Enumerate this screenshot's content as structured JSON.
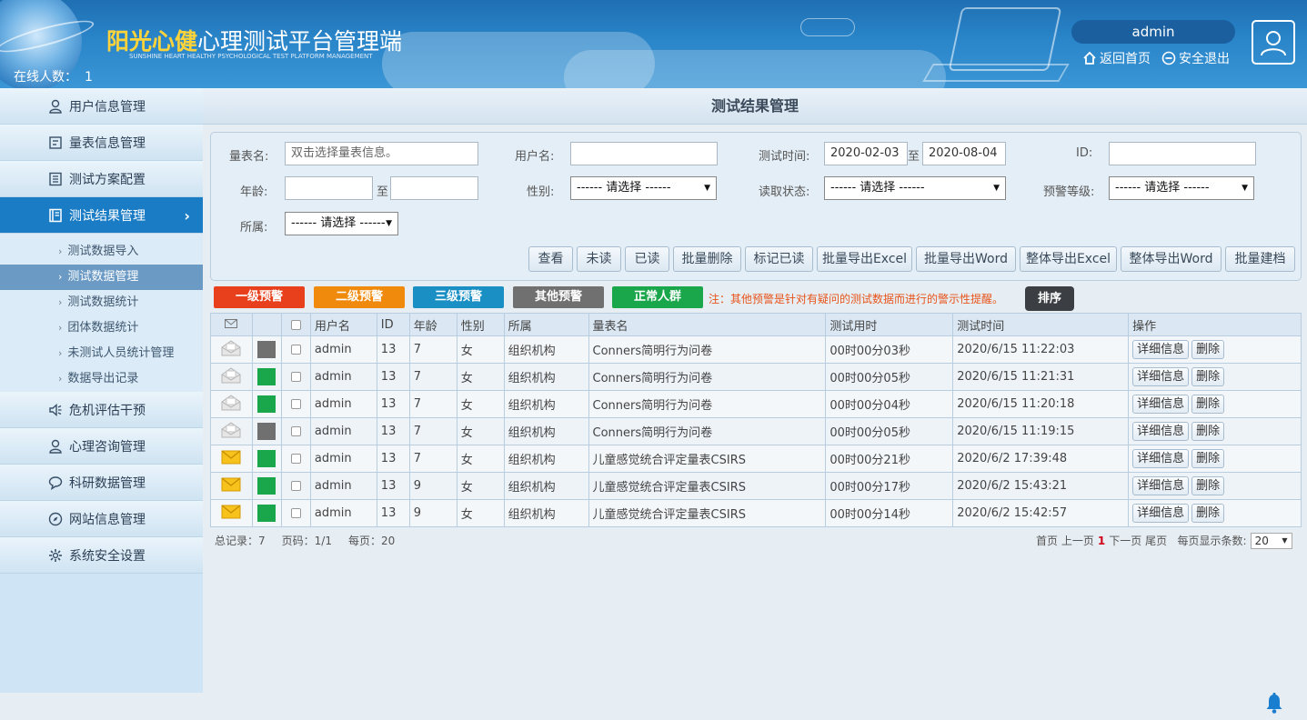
{
  "header": {
    "brand_highlight": "阳光心健",
    "brand_rest": "心理测试平台管理端",
    "brand_sub": "SUNSHINE HEART HEALTHY PSYCHOLOGICAL TEST PLATFORM MANAGEMENT",
    "online_label": "在线人数：",
    "online_count": "1",
    "username": "admin",
    "home_link": "返回首页",
    "logout_link": "安全退出"
  },
  "sidebar": {
    "items": [
      {
        "label": "用户信息管理",
        "icon": "user-icon"
      },
      {
        "label": "量表信息管理",
        "icon": "form-icon"
      },
      {
        "label": "测试方案配置",
        "icon": "book-icon"
      },
      {
        "label": "测试结果管理",
        "icon": "notebook-icon"
      },
      {
        "label": "危机评估干预",
        "icon": "speaker-icon"
      },
      {
        "label": "心理咨询管理",
        "icon": "user-icon"
      },
      {
        "label": "科研数据管理",
        "icon": "chat-icon"
      },
      {
        "label": "网站信息管理",
        "icon": "compass-icon"
      },
      {
        "label": "系统安全设置",
        "icon": "gear-icon"
      }
    ],
    "sub_items": [
      {
        "label": "测试数据导入"
      },
      {
        "label": "测试数据管理"
      },
      {
        "label": "测试数据统计"
      },
      {
        "label": "团体数据统计"
      },
      {
        "label": "未测试人员统计管理"
      },
      {
        "label": "数据导出记录"
      }
    ]
  },
  "main": {
    "title": "测试结果管理",
    "filters": {
      "scale_label": "量表名:",
      "scale_placeholder": "双击选择量表信息。",
      "username_label": "用户名:",
      "username_value": "",
      "test_time_label": "测试时间:",
      "date_from": "2020-02-03",
      "date_to_sep": "至",
      "date_to": "2020-08-04",
      "id_label": "ID:",
      "id_value": "",
      "age_label": "年龄:",
      "age_sep": "至",
      "gender_label": "性别:",
      "gender_value": "------ 请选择 ------",
      "read_label": "读取状态:",
      "read_value": "------ 请选择 ------",
      "warn_label": "预警等级:",
      "warn_value": "------ 请选择 ------",
      "org_label": "所属:",
      "org_value": "------ 请选择 ------"
    },
    "actions": [
      "查看",
      "未读",
      "已读",
      "批量删除",
      "标记已读",
      "批量导出Excel",
      "批量导出Word",
      "整体导出Excel",
      "整体导出Word",
      "批量建档"
    ],
    "tags": [
      {
        "label": "一级预警",
        "color": "#e8401c"
      },
      {
        "label": "二级预警",
        "color": "#f08a0c"
      },
      {
        "label": "三级预警",
        "color": "#1a8fc4"
      },
      {
        "label": "其他预警",
        "color": "#707070"
      },
      {
        "label": "正常人群",
        "color": "#1aa64a"
      }
    ],
    "note": "注：其他预警是针对有疑问的测试数据而进行的警示性提醒。",
    "sort_label": "排序",
    "table": {
      "headers": [
        "",
        "",
        "",
        "用户名",
        "ID",
        "年龄",
        "性别",
        "所属",
        "量表名",
        "测试用时",
        "测试时间",
        "操作"
      ],
      "rows": [
        {
          "read": true,
          "status_color": "#707070",
          "user": "admin",
          "id": "13",
          "age": "7",
          "gender": "女",
          "org": "组织机构",
          "scale": "Conners简明行为问卷",
          "duration": "00时00分03秒",
          "time": "2020/6/15 11:22:03"
        },
        {
          "read": true,
          "status_color": "#1aa64a",
          "user": "admin",
          "id": "13",
          "age": "7",
          "gender": "女",
          "org": "组织机构",
          "scale": "Conners简明行为问卷",
          "duration": "00时00分05秒",
          "time": "2020/6/15 11:21:31"
        },
        {
          "read": true,
          "status_color": "#1aa64a",
          "user": "admin",
          "id": "13",
          "age": "7",
          "gender": "女",
          "org": "组织机构",
          "scale": "Conners简明行为问卷",
          "duration": "00时00分04秒",
          "time": "2020/6/15 11:20:18"
        },
        {
          "read": true,
          "status_color": "#707070",
          "user": "admin",
          "id": "13",
          "age": "7",
          "gender": "女",
          "org": "组织机构",
          "scale": "Conners简明行为问卷",
          "duration": "00时00分05秒",
          "time": "2020/6/15 11:19:15"
        },
        {
          "read": false,
          "status_color": "#1aa64a",
          "user": "admin",
          "id": "13",
          "age": "7",
          "gender": "女",
          "org": "组织机构",
          "scale": "儿童感觉统合评定量表CSIRS",
          "duration": "00时00分21秒",
          "time": "2020/6/2 17:39:48"
        },
        {
          "read": false,
          "status_color": "#1aa64a",
          "user": "admin",
          "id": "13",
          "age": "9",
          "gender": "女",
          "org": "组织机构",
          "scale": "儿童感觉统合评定量表CSIRS",
          "duration": "00时00分17秒",
          "time": "2020/6/2 15:43:21"
        },
        {
          "read": false,
          "status_color": "#1aa64a",
          "user": "admin",
          "id": "13",
          "age": "9",
          "gender": "女",
          "org": "组织机构",
          "scale": "儿童感觉统合评定量表CSIRS",
          "duration": "00时00分14秒",
          "time": "2020/6/2 15:42:57"
        }
      ],
      "detail_label": "详细信息",
      "delete_label": "删除"
    },
    "footer": {
      "total": "总记录：7",
      "page": "页码：1/1",
      "per_page": "每页：20",
      "first": "首页",
      "prev": "上一页",
      "current": "1",
      "next": "下一页",
      "last": "尾页",
      "size_label": "每页显示条数:",
      "size_value": "20"
    }
  }
}
